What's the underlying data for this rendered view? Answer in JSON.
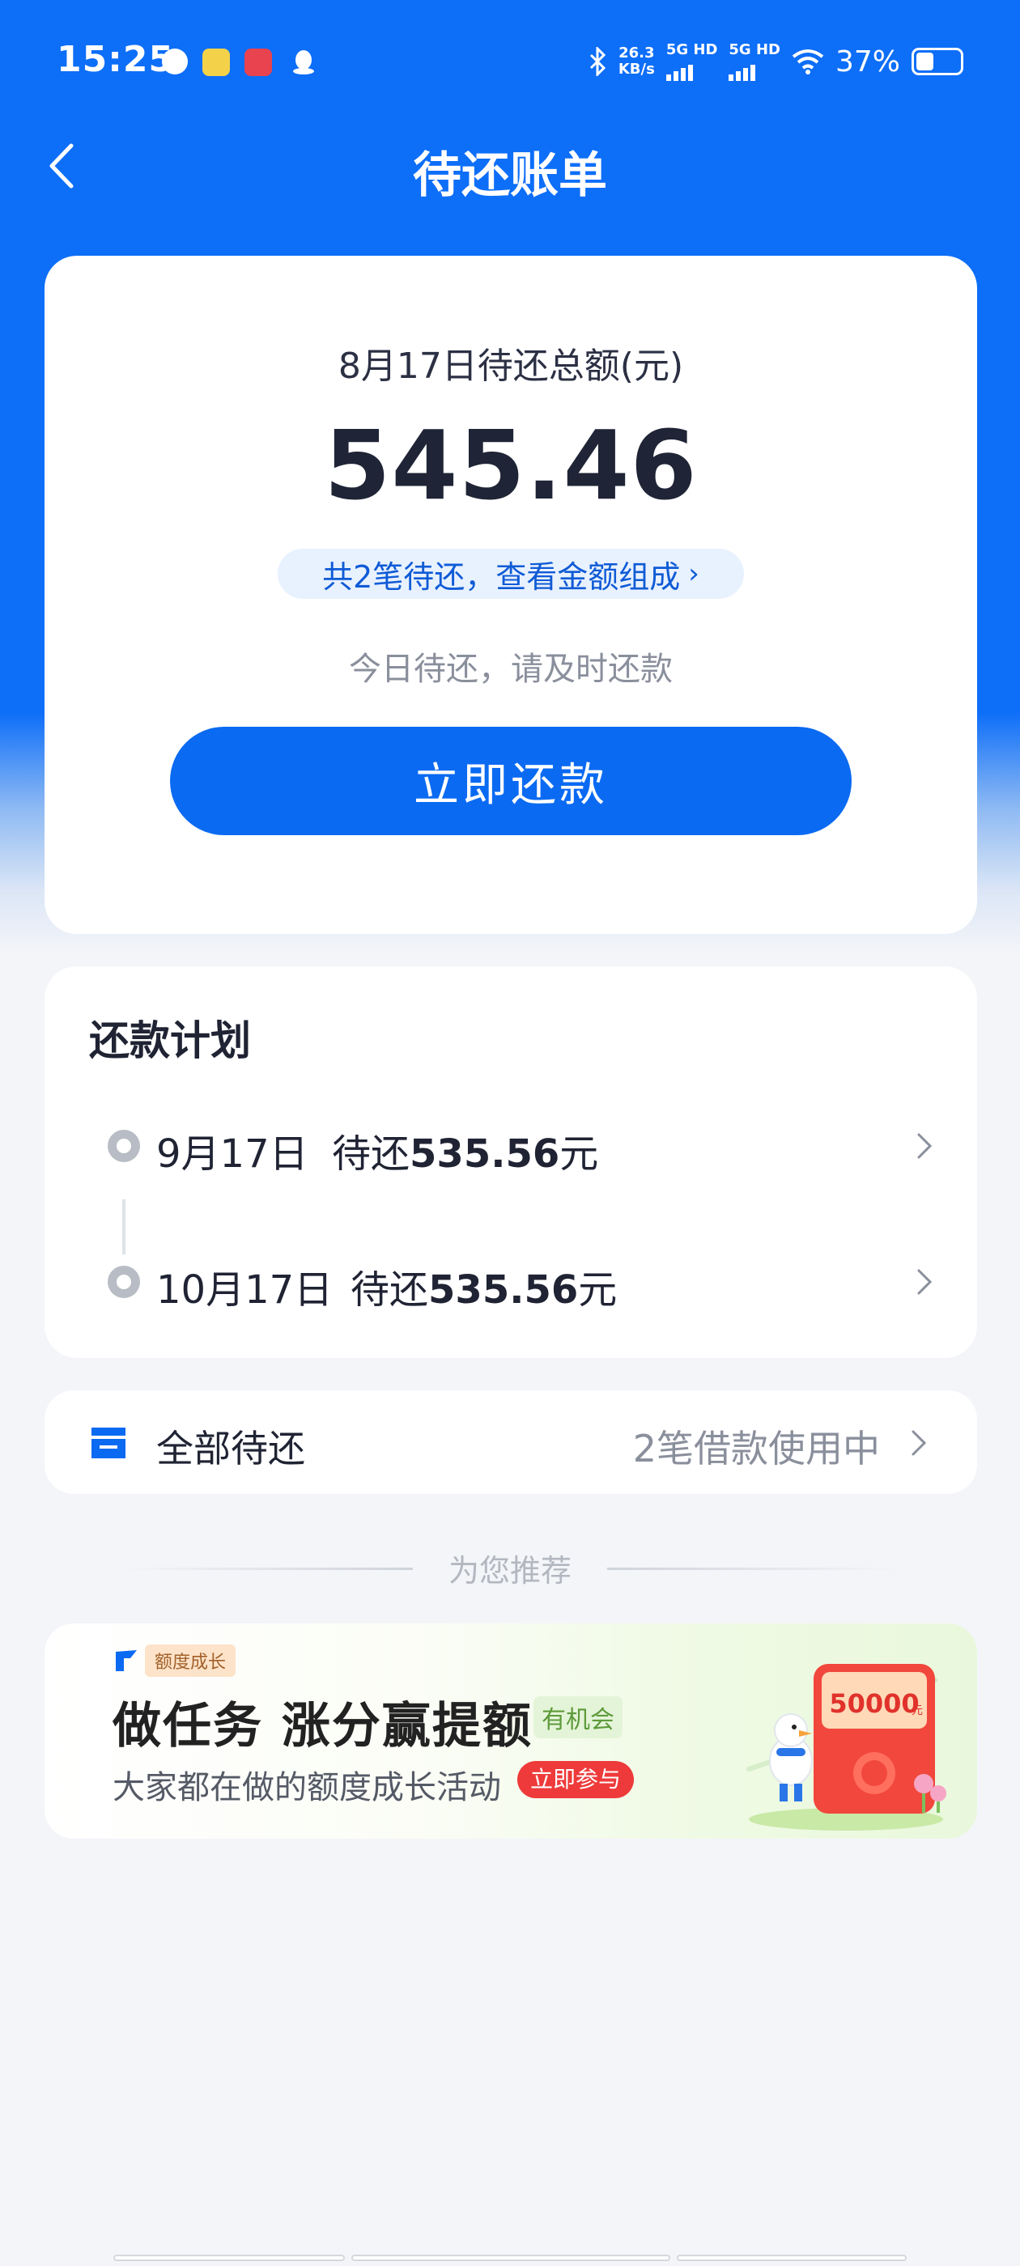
{
  "status_bar": {
    "time": "15:25",
    "net_speed_value": "26.3",
    "net_speed_unit": "KB/s",
    "sim1": "5G HD",
    "sim2": "5G HD",
    "battery": "37%"
  },
  "header": {
    "title": "待还账单"
  },
  "summary": {
    "label": "8月17日待还总额(元)",
    "amount": "545.46",
    "breakdown_link": "共2笔待还，查看金额组成",
    "hint": "今日待还，请及时还款",
    "repay_button": "立即还款"
  },
  "plan": {
    "title": "还款计划",
    "items": [
      {
        "date": "9月17日",
        "prefix": "待还",
        "amount": "535.56",
        "unit": "元"
      },
      {
        "date": "10月17日",
        "prefix": "待还",
        "amount": "535.56",
        "unit": "元"
      }
    ]
  },
  "all_pending": {
    "label": "全部待还",
    "status": "2笔借款使用中"
  },
  "recommend": {
    "divider_text": "为您推荐"
  },
  "banner": {
    "tag": "额度成长",
    "title": "做任务 涨分赢提额",
    "chance_badge": "有机会",
    "subtitle": "大家都在做的额度成长活动",
    "join_button": "立即参与",
    "gift_amount": "50000",
    "gift_unit": "元"
  },
  "colors": {
    "primary": "#0a6af2",
    "header_bg": "#0d6ef8",
    "page_bg": "#f4f5f9",
    "promo_red": "#ee3a3a"
  }
}
